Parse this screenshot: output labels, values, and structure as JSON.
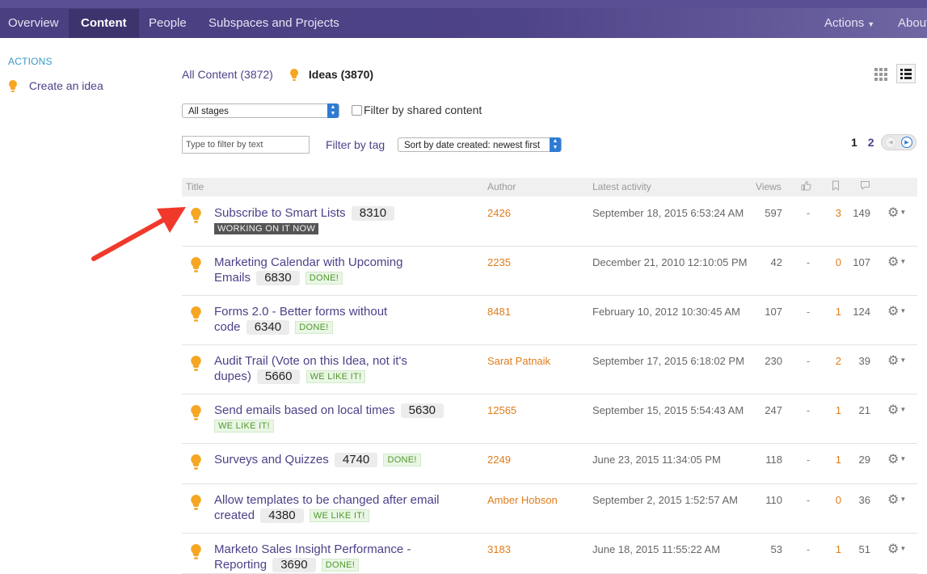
{
  "nav": {
    "items": [
      "Overview",
      "Content",
      "People",
      "Subspaces and Projects"
    ],
    "actions": "Actions",
    "about": "About"
  },
  "sidebar": {
    "heading": "ACTIONS",
    "create_idea": "Create an idea"
  },
  "tabs": {
    "all": "All Content (3872)",
    "ideas": "Ideas (3870)"
  },
  "filters": {
    "stage": "All stages",
    "shared": "Filter by shared content",
    "text_placeholder": "Type to filter by text",
    "tag": "Filter by tag",
    "sort": "Sort by date created: newest first"
  },
  "pagination": {
    "current": "1",
    "next": "2"
  },
  "table": {
    "headers": {
      "title": "Title",
      "author": "Author",
      "latest": "Latest activity",
      "views": "Views"
    },
    "rows": [
      {
        "title": "Subscribe to Smart Lists",
        "votes": "8310",
        "status": "WORKING ON IT NOW",
        "author": "2426",
        "latest": "September 18, 2015 6:53:24 AM",
        "views": "597",
        "likes": "-",
        "bookmarks": "3",
        "comments": "149"
      },
      {
        "title": "Marketing Calendar with Upcoming Emails",
        "votes": "6830",
        "status": "DONE!",
        "author": "2235",
        "latest": "December 21, 2010 12:10:05 PM",
        "views": "42",
        "likes": "-",
        "bookmarks": "0",
        "comments": "107"
      },
      {
        "title": "Forms 2.0 - Better forms without code",
        "votes": "6340",
        "status": "DONE!",
        "author": "8481",
        "latest": "February 10, 2012 10:30:45 AM",
        "views": "107",
        "likes": "-",
        "bookmarks": "1",
        "comments": "124"
      },
      {
        "title": "Audit Trail (Vote on this Idea, not it's dupes)",
        "votes": "5660",
        "status": "WE LIKE IT!",
        "author": "Sarat Patnaik",
        "latest": "September 17, 2015 6:18:02 PM",
        "views": "230",
        "likes": "-",
        "bookmarks": "2",
        "comments": "39"
      },
      {
        "title": "Send emails based on local times",
        "votes": "5630",
        "status": "WE LIKE IT!",
        "author": "12565",
        "latest": "September 15, 2015 5:54:43 AM",
        "views": "247",
        "likes": "-",
        "bookmarks": "1",
        "comments": "21"
      },
      {
        "title": "Surveys and Quizzes",
        "votes": "4740",
        "status": "DONE!",
        "author": "2249",
        "latest": "June 23, 2015 11:34:05 PM",
        "views": "118",
        "likes": "-",
        "bookmarks": "1",
        "comments": "29"
      },
      {
        "title": "Allow templates to be changed after email created",
        "votes": "4380",
        "status": "WE LIKE IT!",
        "author": "Amber Hobson",
        "latest": "September 2, 2015 1:52:57 AM",
        "views": "110",
        "likes": "-",
        "bookmarks": "0",
        "comments": "36"
      },
      {
        "title": "Marketo Sales Insight Performance - Reporting",
        "votes": "3690",
        "status": "DONE!",
        "author": "3183",
        "latest": "June 18, 2015 11:55:22 AM",
        "views": "53",
        "likes": "-",
        "bookmarks": "1",
        "comments": "51"
      }
    ]
  },
  "icons": {
    "bulb": "lightbulb-icon",
    "gear": "gear-icon",
    "like": "thumbs-up-icon",
    "bookmark": "bookmark-icon",
    "comment": "comment-icon",
    "grid": "grid-view-icon",
    "list": "list-view-icon",
    "annotation": "red-arrow"
  },
  "colors": {
    "nav": "#4a3f80",
    "link": "#4b4289",
    "author": "#e07d1a",
    "bulb": "#f5a623",
    "arrow": "#f0392b"
  }
}
